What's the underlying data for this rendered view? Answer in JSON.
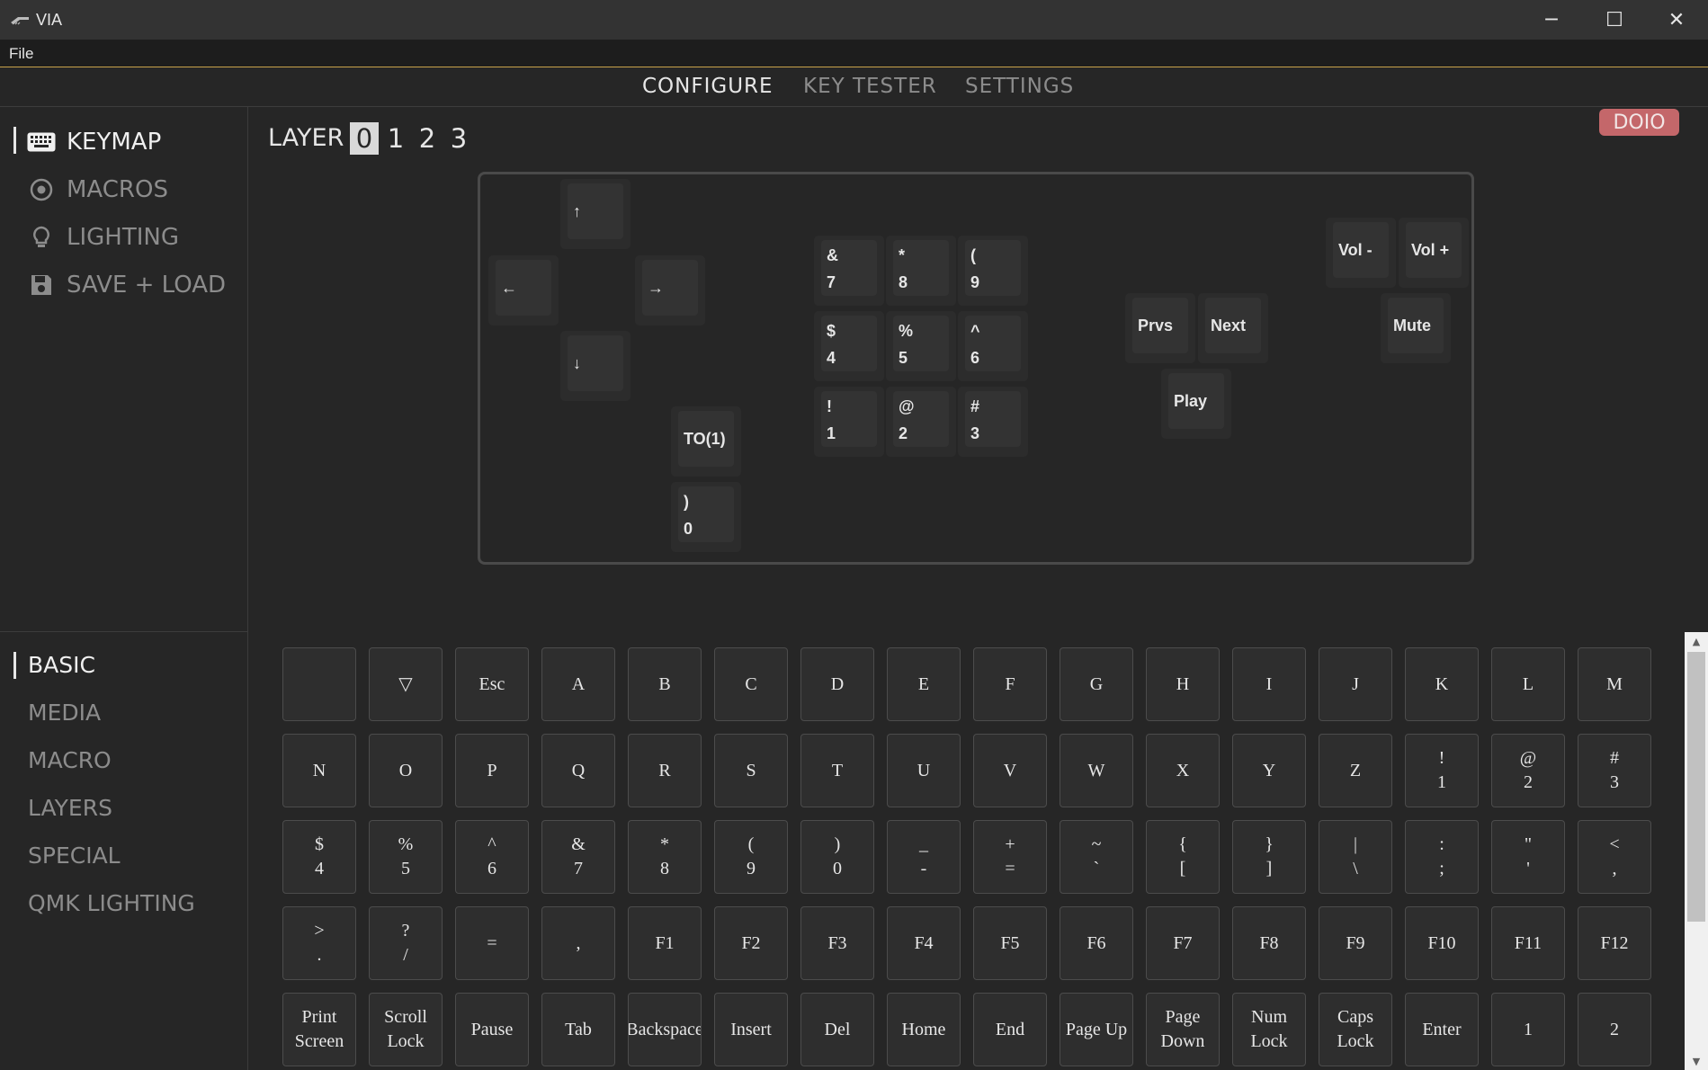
{
  "window": {
    "title": "VIA",
    "minimize": "─",
    "maximize": "☐",
    "close": "✕"
  },
  "menubar": {
    "file": "File"
  },
  "topnav": {
    "configure": "CONFIGURE",
    "key_tester": "KEY TESTER",
    "settings": "SETTINGS"
  },
  "sidebar": {
    "menu": [
      {
        "label": "KEYMAP",
        "icon": "keyboard-icon"
      },
      {
        "label": "MACROS",
        "icon": "circle-dot-icon"
      },
      {
        "label": "LIGHTING",
        "icon": "lightbulb-icon"
      },
      {
        "label": "SAVE + LOAD",
        "icon": "floppy-disk-icon"
      }
    ],
    "categories": [
      "BASIC",
      "MEDIA",
      "MACRO",
      "LAYERS",
      "SPECIAL",
      "QMK LIGHTING"
    ]
  },
  "layer": {
    "label": "LAYER",
    "layers": [
      "0",
      "1",
      "2",
      "3"
    ],
    "selected": "0"
  },
  "brand_badge": "DOIO",
  "keyboard_keys": [
    {
      "top": "↑",
      "bottom": ""
    },
    {
      "top": "←",
      "bottom": ""
    },
    {
      "top": "→",
      "bottom": ""
    },
    {
      "top": "↓",
      "bottom": ""
    },
    {
      "top": "TO(1)",
      "bottom": ""
    },
    {
      "top": ")",
      "bottom": "0"
    },
    {
      "top": "&",
      "bottom": "7"
    },
    {
      "top": "*",
      "bottom": "8"
    },
    {
      "top": "(",
      "bottom": "9"
    },
    {
      "top": "$",
      "bottom": "4"
    },
    {
      "top": "%",
      "bottom": "5"
    },
    {
      "top": "^",
      "bottom": "6"
    },
    {
      "top": "!",
      "bottom": "1"
    },
    {
      "top": "@",
      "bottom": "2"
    },
    {
      "top": "#",
      "bottom": "3"
    },
    {
      "top": "Prvs",
      "bottom": ""
    },
    {
      "top": "Next",
      "bottom": ""
    },
    {
      "top": "Play",
      "bottom": ""
    },
    {
      "top": "Vol -",
      "bottom": ""
    },
    {
      "top": "Vol +",
      "bottom": ""
    },
    {
      "top": "Mute",
      "bottom": ""
    }
  ],
  "key_grid": [
    [
      "",
      "▽",
      "Esc",
      "A",
      "B",
      "C",
      "D",
      "E",
      "F",
      "G",
      "H",
      "I",
      "J",
      "K",
      "L",
      "M"
    ],
    [
      "N",
      "O",
      "P",
      "Q",
      "R",
      "S",
      "T",
      "U",
      "V",
      "W",
      "X",
      "Y",
      "Z",
      "!\n1",
      "@\n2",
      "#\n3"
    ],
    [
      "$\n4",
      "%\n5",
      "^\n6",
      "&\n7",
      "*\n8",
      "(\n9",
      ")\n0",
      "_\n-",
      "+\n=",
      "~\n`",
      "{\n[",
      "}\n]",
      "|\n\\",
      ":\n;",
      "\"\n'",
      "<\n,"
    ],
    [
      ">\n.",
      "?\n/",
      "=",
      ",",
      "F1",
      "F2",
      "F3",
      "F4",
      "F5",
      "F6",
      "F7",
      "F8",
      "F9",
      "F10",
      "F11",
      "F12"
    ],
    [
      "Print\nScreen",
      "Scroll\nLock",
      "Pause",
      "Tab",
      "Backspace",
      "Insert",
      "Del",
      "Home",
      "End",
      "Page Up",
      "Page\nDown",
      "Num\nLock",
      "Caps\nLock",
      "Enter",
      "1",
      "2"
    ]
  ],
  "colors": {
    "background": "#262626",
    "brand": "#c4676a",
    "accent_line": "#c8a24a"
  }
}
